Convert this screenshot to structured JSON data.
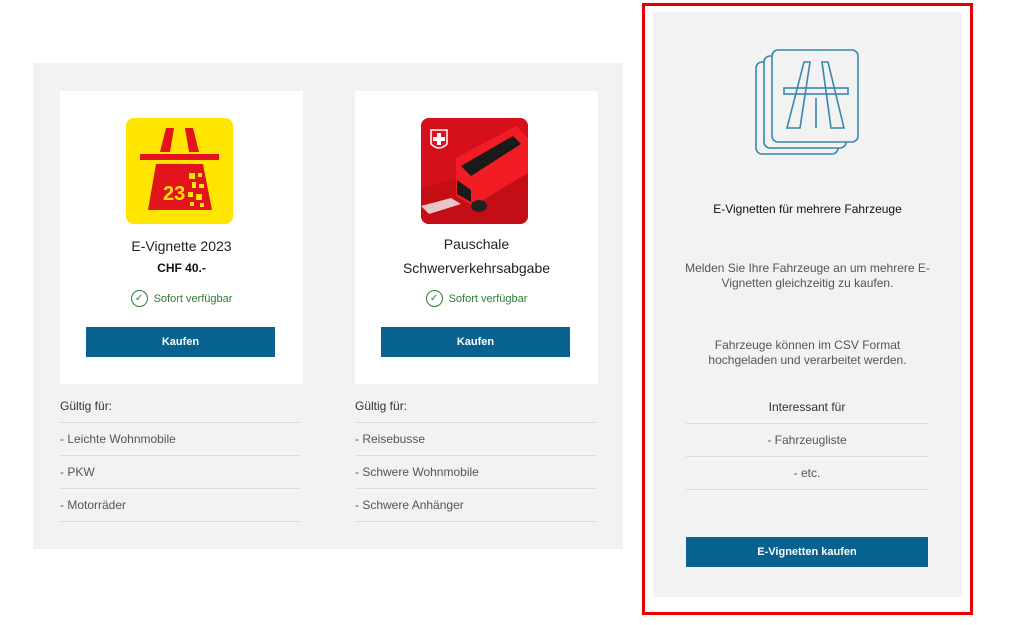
{
  "products": [
    {
      "title_lines": [
        "E-Vignette 2023"
      ],
      "price": "CHF 40.-",
      "availability": "Sofort verfügbar",
      "button": "Kaufen",
      "valid_heading": "Gültig für:",
      "valid_items": [
        "- Leichte Wohnmobile",
        "- PKW",
        "- Motorräder"
      ],
      "image_text": "23",
      "image_color": "#ffe500"
    },
    {
      "title_lines": [
        "Pauschale",
        "Schwerverkehrsabgabe"
      ],
      "price": "",
      "availability": "Sofort verfügbar",
      "button": "Kaufen",
      "valid_heading": "Gültig für:",
      "valid_items": [
        "- Reisebusse",
        "- Schwere Wohnmobile",
        "- Schwere Anhänger"
      ],
      "image_color": "#e3131b"
    }
  ],
  "multi": {
    "title": "E-Vignetten für mehrere Fahrzeuge",
    "desc1": "Melden Sie Ihre Fahrzeuge an um mehrere E-Vignetten gleichzeitig zu kaufen.",
    "desc2": "Fahrzeuge können im CSV Format hochgeladen und verarbeitet werden.",
    "interest_heading": "Interessant für",
    "interest_items": [
      "- Fahrzeugliste",
      "- etc."
    ],
    "button": "E-Vignetten kaufen",
    "icon": "highway-cards-icon"
  },
  "colors": {
    "primary_button": "#07628f",
    "available_green": "#2e7d32",
    "highlight_outline": "#e60000",
    "panel_bg": "#f2f2f2"
  }
}
